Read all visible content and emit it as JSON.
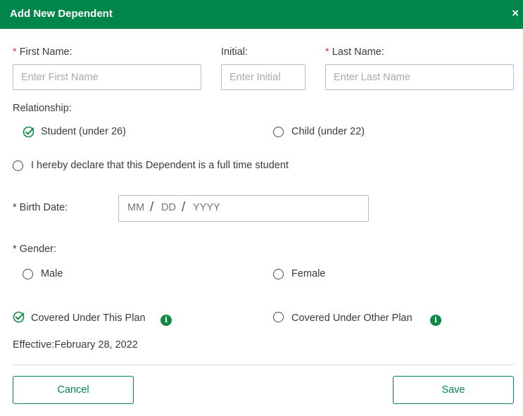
{
  "dialog": {
    "title": "Add New Dependent",
    "close_glyph": "×"
  },
  "form": {
    "first_name": {
      "label": "First Name:",
      "required_mark": "*",
      "placeholder": "Enter First Name",
      "value": ""
    },
    "initial": {
      "label": "Initial:",
      "placeholder": "Enter Initial",
      "value": ""
    },
    "last_name": {
      "label": "Last Name:",
      "required_mark": "*",
      "placeholder": "Enter Last Name",
      "value": ""
    },
    "relationship": {
      "label": "Relationship:",
      "options": [
        {
          "label": "Student (under 26)",
          "selected": true,
          "icon": "check-circle-icon"
        },
        {
          "label": "Child (under 22)",
          "selected": false,
          "icon": "radio-icon"
        }
      ]
    },
    "declaration": {
      "label": "I hereby declare that this Dependent is a full time student",
      "selected": false
    },
    "birth_date": {
      "label": "* Birth Date:",
      "month_placeholder": "MM",
      "day_placeholder": "DD",
      "year_placeholder": "YYYY",
      "separator": "/"
    },
    "gender": {
      "label": "* Gender:",
      "options": [
        {
          "label": "Male",
          "selected": false
        },
        {
          "label": "Female",
          "selected": false
        }
      ]
    },
    "coverage": {
      "options": [
        {
          "label": "Covered Under This Plan",
          "selected": true,
          "info_glyph": "i"
        },
        {
          "label": "Covered Under Other Plan",
          "selected": false,
          "info_glyph": "i"
        }
      ]
    },
    "effective": "Effective:February 28, 2022"
  },
  "buttons": {
    "cancel": "Cancel",
    "save": "Save"
  },
  "colors": {
    "brand_green": "#00854a",
    "required_red": "#d43b3b",
    "placeholder_gray": "#a6a9ad"
  }
}
